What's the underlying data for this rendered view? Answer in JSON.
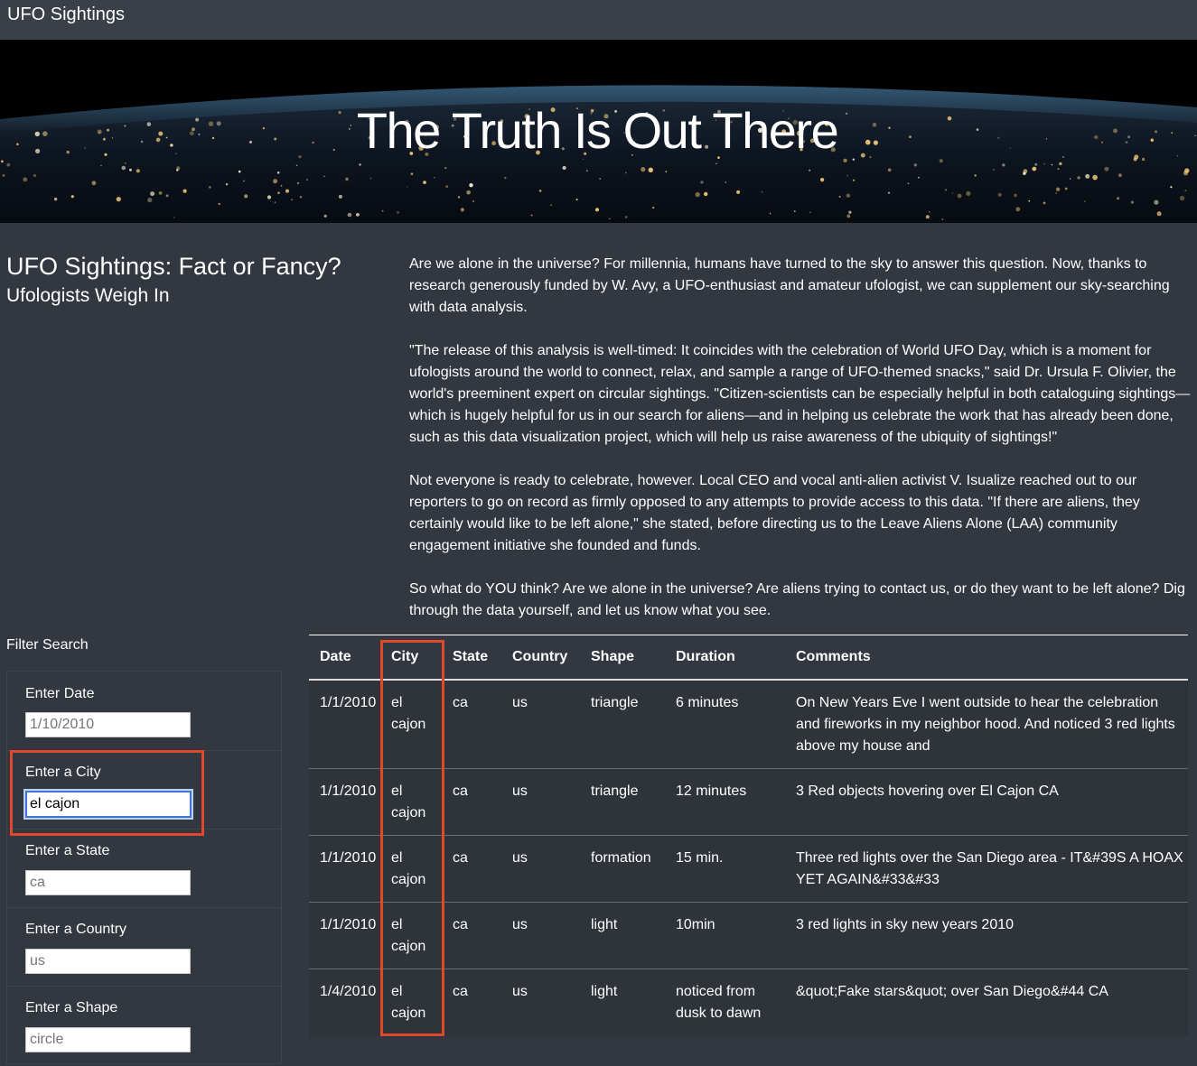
{
  "navbar": {
    "brand": "UFO Sightings"
  },
  "hero": {
    "title": "The Truth Is Out There"
  },
  "intro": {
    "heading": "UFO Sightings: Fact or Fancy?",
    "subheading": "Ufologists Weigh In",
    "paragraphs": [
      "Are we alone in the universe? For millennia, humans have turned to the sky to answer this question. Now, thanks to research generously funded by W. Avy, a UFO-enthusiast and amateur ufologist, we can supplement our sky-searching with data analysis.",
      "\"The release of this analysis is well-timed: It coincides with the celebration of World UFO Day, which is a moment for ufologists around the world to connect, relax, and sample a range of UFO-themed snacks,\" said Dr. Ursula F. Olivier, the world's preeminent expert on circular sightings. \"Citizen-scientists can be especially helpful in both cataloguing sightings—which is hugely helpful for us in our search for aliens—and in helping us celebrate the work that has already been done, such as this data visualization project, which will help us raise awareness of the ubiquity of sightings!\"",
      "Not everyone is ready to celebrate, however. Local CEO and vocal anti-alien activist V. Isualize reached out to our reporters to go on record as firmly opposed to any attempts to provide access to this data. \"If there are aliens, they certainly would like to be left alone,\" she stated, before directing us to the Leave Aliens Alone (LAA) community engagement initiative she founded and funds.",
      "So what do YOU think? Are we alone in the universe? Are aliens trying to contact us, or do they want to be left alone? Dig through the data yourself, and let us know what you see."
    ]
  },
  "filters": {
    "title": "Filter Search",
    "date": {
      "label": "Enter Date",
      "placeholder": "1/10/2010",
      "value": ""
    },
    "city": {
      "label": "Enter a City",
      "placeholder": "",
      "value": "el cajon"
    },
    "state": {
      "label": "Enter a State",
      "placeholder": "ca",
      "value": ""
    },
    "country": {
      "label": "Enter a Country",
      "placeholder": "us",
      "value": ""
    },
    "shape": {
      "label": "Enter a Shape",
      "placeholder": "circle",
      "value": ""
    }
  },
  "table": {
    "headers": [
      "Date",
      "City",
      "State",
      "Country",
      "Shape",
      "Duration",
      "Comments"
    ],
    "rows": [
      [
        "1/1/2010",
        "el cajon",
        "ca",
        "us",
        "triangle",
        "6 minutes",
        "On New Years Eve I went outside to hear the celebration and fireworks in my neighbor hood. And noticed 3 red lights above my house and"
      ],
      [
        "1/1/2010",
        "el cajon",
        "ca",
        "us",
        "triangle",
        "12 minutes",
        "3 Red objects hovering over El Cajon CA"
      ],
      [
        "1/1/2010",
        "el cajon",
        "ca",
        "us",
        "formation",
        "15 min.",
        "Three red lights over the San Diego area - IT&#39S A HOAX YET AGAIN&#33&#33"
      ],
      [
        "1/1/2010",
        "el cajon",
        "ca",
        "us",
        "light",
        "10min",
        "3 red lights in sky new years 2010"
      ],
      [
        "1/4/2010",
        "el cajon",
        "ca",
        "us",
        "light",
        "noticed from dusk to dawn",
        "&quot;Fake stars&quot; over San Diego&#44 CA"
      ]
    ]
  },
  "colors": {
    "highlight": "#e0472b",
    "background": "#323740",
    "navbar": "#3b4048"
  }
}
